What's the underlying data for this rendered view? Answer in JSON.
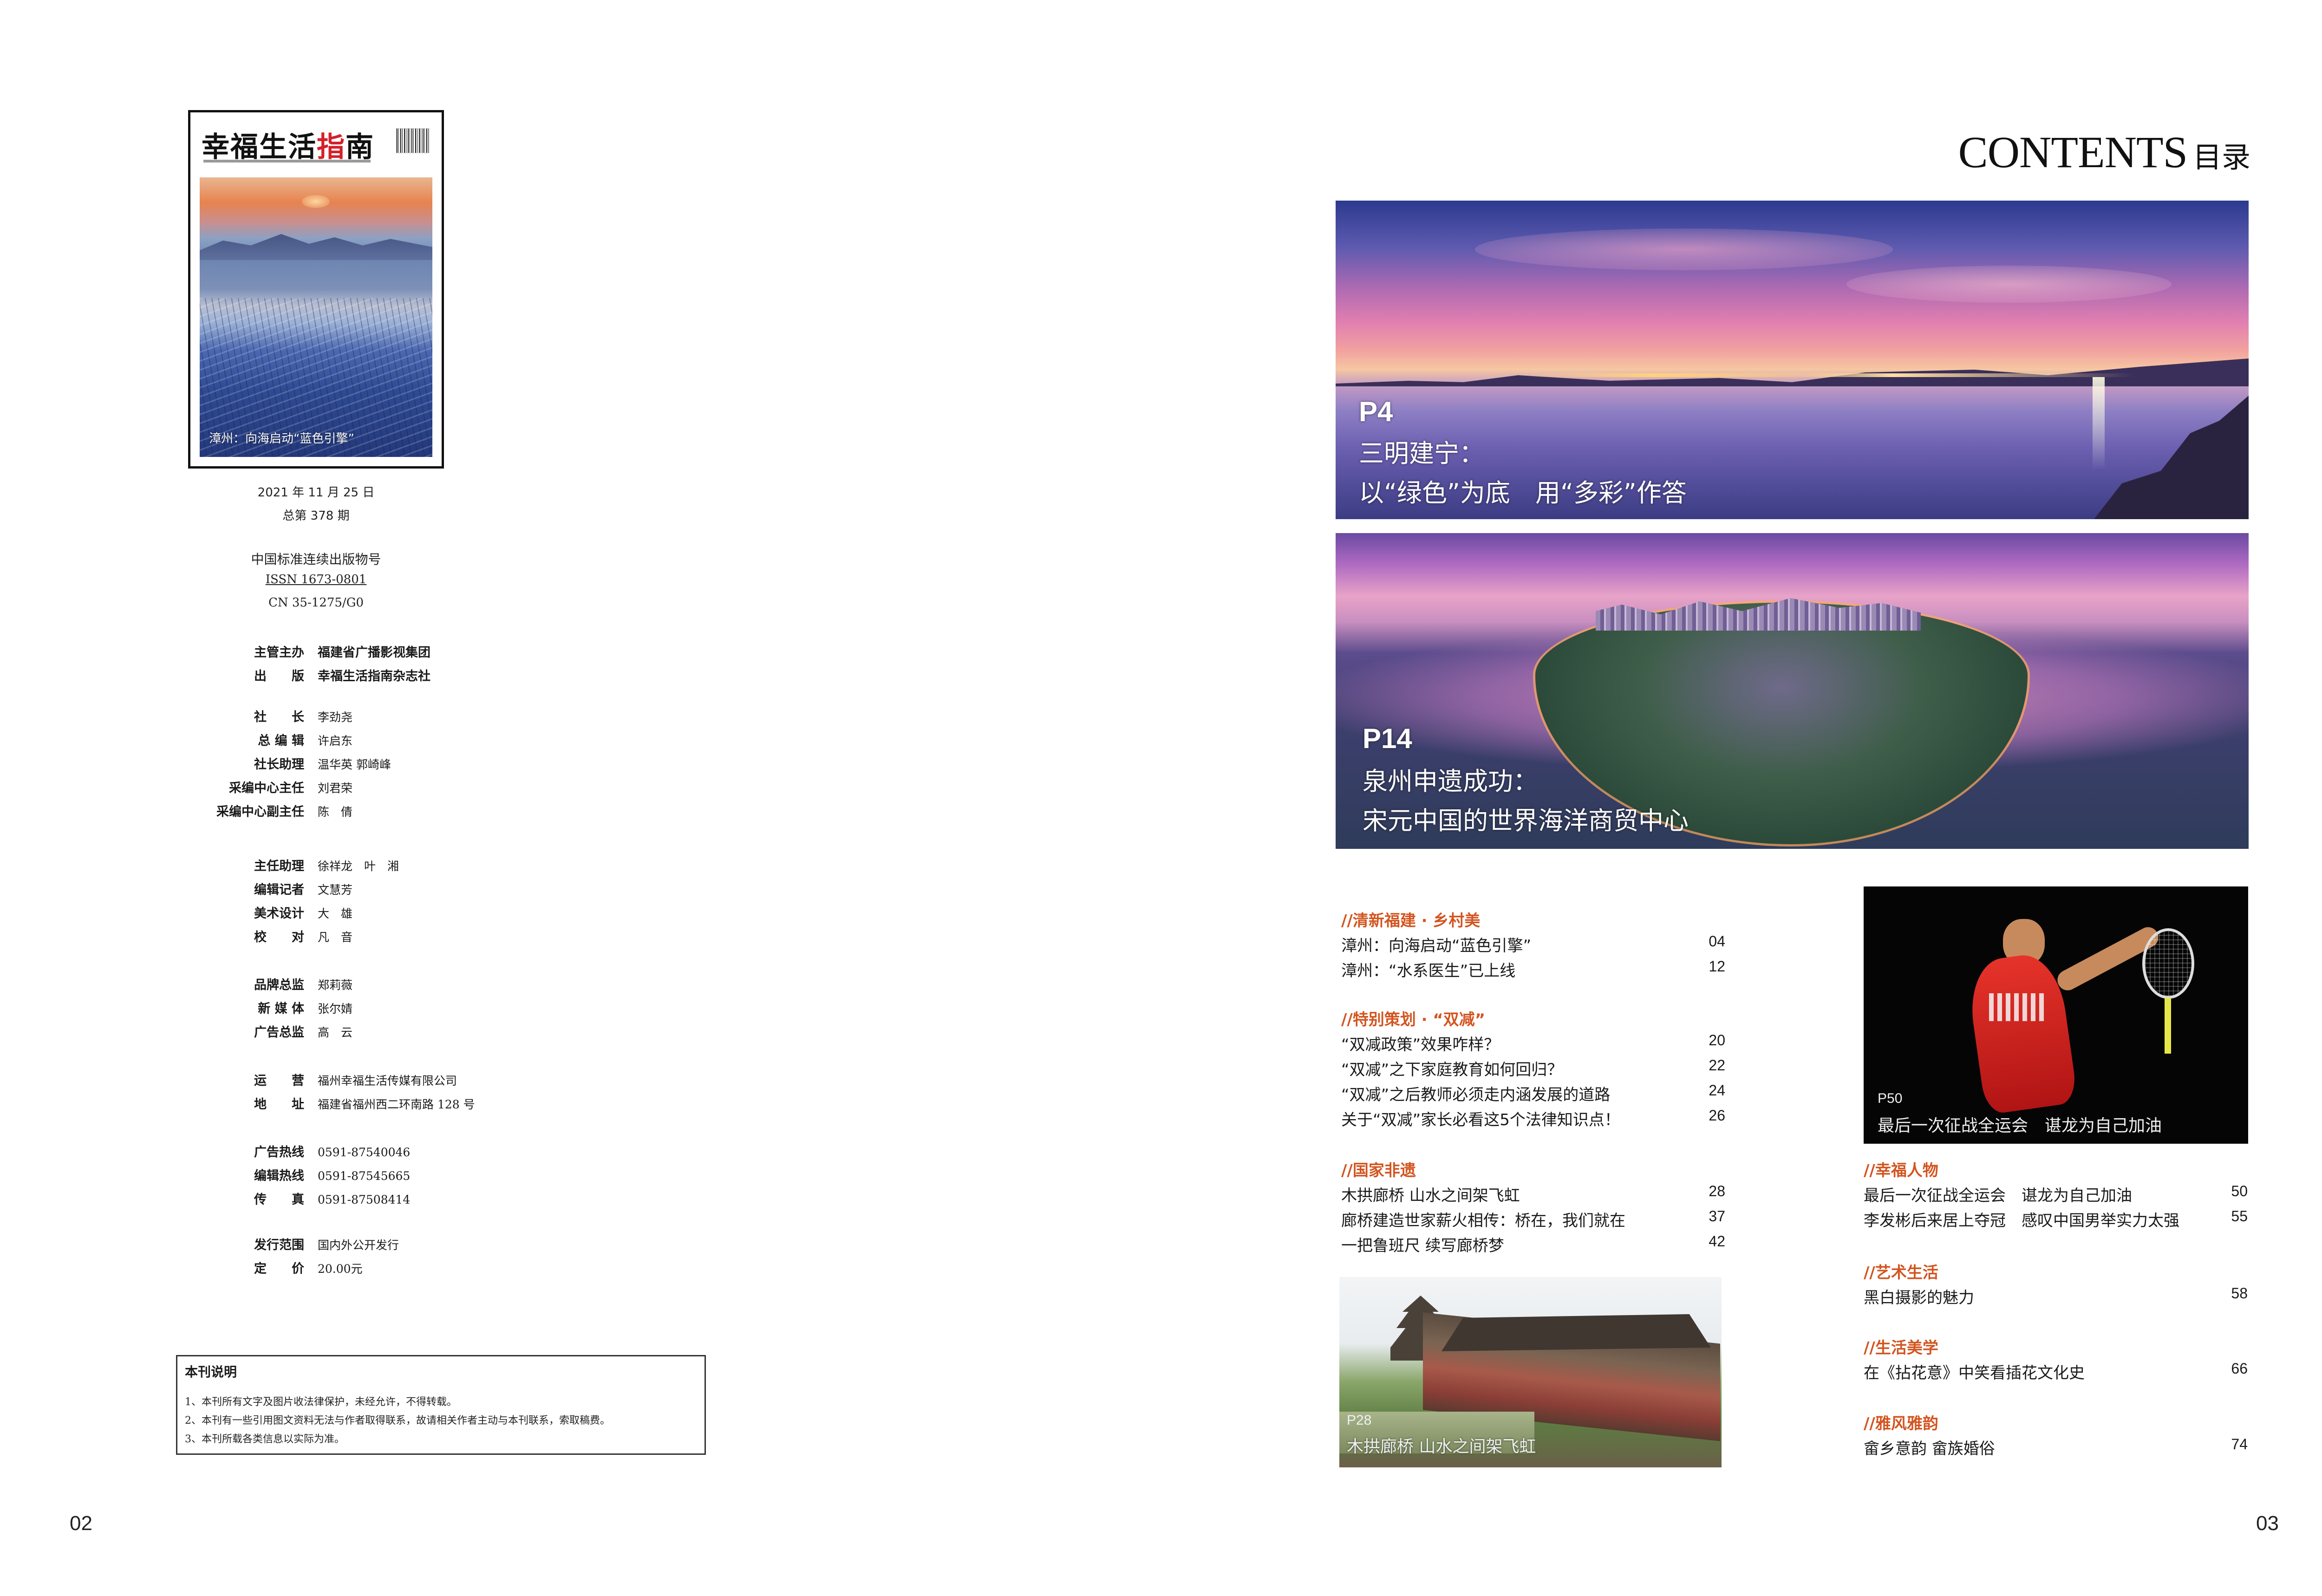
{
  "left_page": {
    "cover": {
      "masthead": "幸福生活指南",
      "caption": "漳州：向海启动“蓝色引擎”"
    },
    "issue": {
      "date": "2021 年 11 月 25 日",
      "number": "总第 378 期"
    },
    "serial": {
      "heading": "中国标准连续出版物号",
      "issn": "ISSN 1673-0801",
      "cn": "CN 35-1275/G0"
    },
    "publisher": [
      {
        "label": "主管主办",
        "value": "福建省广播影视集团"
      },
      {
        "label": "出　　版",
        "value": "幸福生活指南杂志社"
      }
    ],
    "masthead_staff": [
      {
        "label": "社　　长",
        "value": "李劲尧"
      },
      {
        "label": "总 编 辑",
        "value": "许启东"
      },
      {
        "label": "社长助理",
        "value": "温华英  郭崎峰"
      },
      {
        "label": "采编中心主任",
        "value": "刘君荣"
      },
      {
        "label": "采编中心副主任",
        "value": "陈　倩"
      }
    ],
    "editorial_staff": [
      {
        "label": "主任助理",
        "value": "徐祥龙　叶　湘"
      },
      {
        "label": "编辑记者",
        "value": "文慧芳"
      },
      {
        "label": "美术设计",
        "value": "大　雄"
      },
      {
        "label": "校　　对",
        "value": "凡　音"
      }
    ],
    "brand_staff": [
      {
        "label": "品牌总监",
        "value": "郑莉薇"
      },
      {
        "label": "新 媒 体",
        "value": "张尔婧"
      },
      {
        "label": "广告总监",
        "value": "高　云"
      }
    ],
    "operations": [
      {
        "label": "运　　营",
        "value": "福州幸福生活传媒有限公司"
      },
      {
        "label": "地　　址",
        "value": "福建省福州西二环南路 128 号"
      }
    ],
    "hotlines": [
      {
        "label": "广告热线",
        "value": "0591-87540046"
      },
      {
        "label": "编辑热线",
        "value": "0591-87545665"
      },
      {
        "label": "传　　真",
        "value": "0591-87508414"
      }
    ],
    "distribution": [
      {
        "label": "发行范围",
        "value": "国内外公开发行"
      },
      {
        "label": "定　　价",
        "value": "20.00元"
      }
    ],
    "notice": {
      "title": "本刊说明",
      "lines": [
        "1、本刊所有文字及图片收法律保护，未经允许，不得转载。",
        "2、本刊有一些引用图文资料无法与作者取得联系，故请相关作者主动与本刊联系，索取稿费。",
        "3、本刊所载各类信息以实际为准。"
      ]
    },
    "page_number": "02"
  },
  "right_page": {
    "contents_en": "CONTENTS",
    "contents_cn": "目录",
    "hero1": {
      "page": "P4",
      "line1": "三明建宁：",
      "line2": "以“绿色”为底　用“多彩”作答"
    },
    "hero2": {
      "page": "P14",
      "line1": "泉州申遗成功：",
      "line2": "宋元中国的世界海洋商贸中心"
    },
    "sections_left": [
      {
        "title": "//清新福建 · 乡村美",
        "items": [
          {
            "title": "漳州：向海启动“蓝色引擎”",
            "page": "04"
          },
          {
            "title": "漳州：“水系医生”已上线",
            "page": "12"
          }
        ]
      },
      {
        "title": "//特别策划 · “双减”",
        "items": [
          {
            "title": "“双减政策”效果咋样？",
            "page": "20"
          },
          {
            "title": "“双减”之下家庭教育如何回归？",
            "page": "22"
          },
          {
            "title": "“双减”之后教师必须走内涵发展的道路",
            "page": "24"
          },
          {
            "title": "关于“双减”家长必看这5个法律知识点！",
            "page": "26"
          }
        ]
      },
      {
        "title": "//国家非遗",
        "items": [
          {
            "title": "木拱廊桥  山水之间架飞虹",
            "page": "28"
          },
          {
            "title": "廊桥建造世家薪火相传：桥在，我们就在",
            "page": "37"
          },
          {
            "title": "一把鲁班尺  续写廊桥梦",
            "page": "42"
          }
        ]
      }
    ],
    "sections_right": [
      {
        "title": "//幸福人物",
        "items": [
          {
            "title": "最后一次征战全运会　谌龙为自己加油",
            "page": "50"
          },
          {
            "title": "李发彬后来居上夺冠　感叹中国男举实力太强",
            "page": "55"
          }
        ]
      },
      {
        "title": "//艺术生活",
        "items": [
          {
            "title": "黑白摄影的魅力",
            "page": "58"
          }
        ]
      },
      {
        "title": "//生活美学",
        "items": [
          {
            "title": "在《拈花意》中笑看插花文化史",
            "page": "66"
          }
        ]
      },
      {
        "title": "//雅风雅韵",
        "items": [
          {
            "title": "畲乡意韵  畲族婚俗",
            "page": "74"
          }
        ]
      }
    ],
    "photo_badminton": {
      "page": "P50",
      "caption": "最后一次征战全运会　谌龙为自己加油"
    },
    "photo_bridge": {
      "page": "P28",
      "caption": "木拱廊桥  山水之间架飞虹"
    },
    "page_number": "03"
  }
}
